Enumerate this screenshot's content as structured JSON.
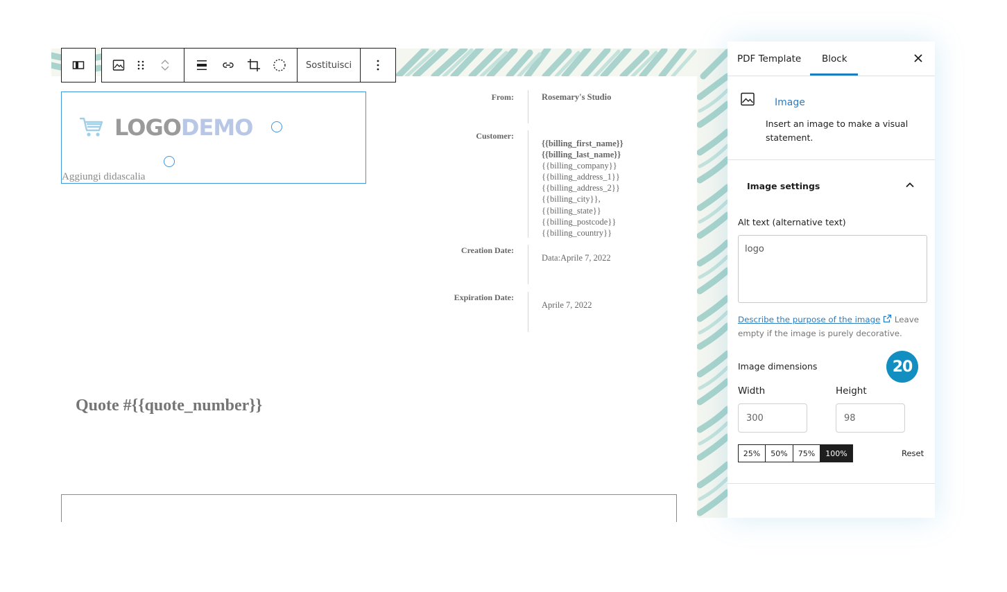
{
  "toolbar": {
    "replace_label": "Sostituisci"
  },
  "image_block": {
    "logo_part1": "LOGO",
    "logo_part2": "DEMO",
    "caption_placeholder": "Aggiungi didascalia"
  },
  "document": {
    "from_label": "From:",
    "from_value": "Rosemary's Studio",
    "customer_label": "Customer:",
    "customer_lines": [
      "{{billing_first_name}}",
      "{{billing_last_name}}",
      "{{billing_company}}",
      "{{billing_address_1}}",
      "{{billing_address_2}}",
      "{{billing_city}},",
      "{{billing_state}}",
      "{{billing_postcode}}",
      "{{billing_country}}"
    ],
    "creation_label": "Creation Date:",
    "creation_value": "Data:Aprile 7, 2022",
    "expiration_label": "Expiration Date:",
    "expiration_value": "Aprile 7, 2022",
    "quote_title": "Quote #{{quote_number}}"
  },
  "sidebar": {
    "tabs": [
      {
        "label": "PDF Template"
      },
      {
        "label": "Block"
      }
    ],
    "active_tab": "Block",
    "block_title": "Image",
    "block_description": "Insert an image to make a visual statement.",
    "settings_title": "Image settings",
    "alt_label": "Alt text (alternative text)",
    "alt_value": "logo",
    "alt_help_link": "Describe the purpose of the image",
    "alt_help_rest": "Leave empty if the image is purely decorative.",
    "dimensions_label": "Image dimensions",
    "step_badge": "20",
    "width_label": "Width",
    "width_value": "300",
    "height_label": "Height",
    "height_value": "98",
    "percent_options": [
      "25%",
      "50%",
      "75%",
      "100%"
    ],
    "percent_selected": "100%",
    "reset_label": "Reset"
  },
  "colors": {
    "accent": "#1e7dbd",
    "badge": "#128fc0",
    "selection": "#3f95e0",
    "pattern": "#a9d3cc"
  }
}
